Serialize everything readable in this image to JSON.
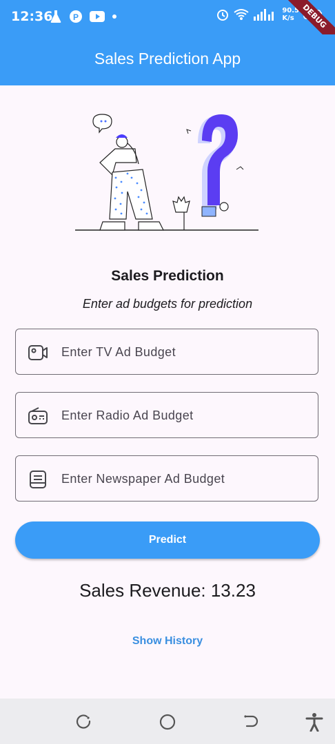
{
  "status_bar": {
    "time": "12:36",
    "network_speed": "90.5\nK/s",
    "icons": [
      "flask-icon",
      "p-icon",
      "youtube-icon",
      "dot-icon",
      "alarm-icon",
      "wifi-icon",
      "signal-icon",
      "battery-icon"
    ],
    "debug_label": "DEBUG"
  },
  "app_bar": {
    "title": "Sales Prediction App"
  },
  "main": {
    "heading": "Sales Prediction",
    "subheading": "Enter ad budgets for prediction",
    "fields": [
      {
        "placeholder": "Enter TV Ad Budget",
        "value": "",
        "icon": "videocam-icon"
      },
      {
        "placeholder": "Enter Radio Ad Budget",
        "value": "",
        "icon": "radio-icon"
      },
      {
        "placeholder": "Enter Newspaper Ad Budget",
        "value": "",
        "icon": "newspaper-icon"
      }
    ],
    "predict_label": "Predict",
    "result_text": "Sales Revenue: 13.23",
    "history_label": "Show History"
  },
  "nav_bar": {
    "icons": [
      "recents-icon",
      "home-icon",
      "back-icon",
      "accessibility-icon"
    ]
  },
  "colors": {
    "primary": "#3a9cf7",
    "background": "#fdf7fd",
    "link": "#3a8fe0"
  }
}
